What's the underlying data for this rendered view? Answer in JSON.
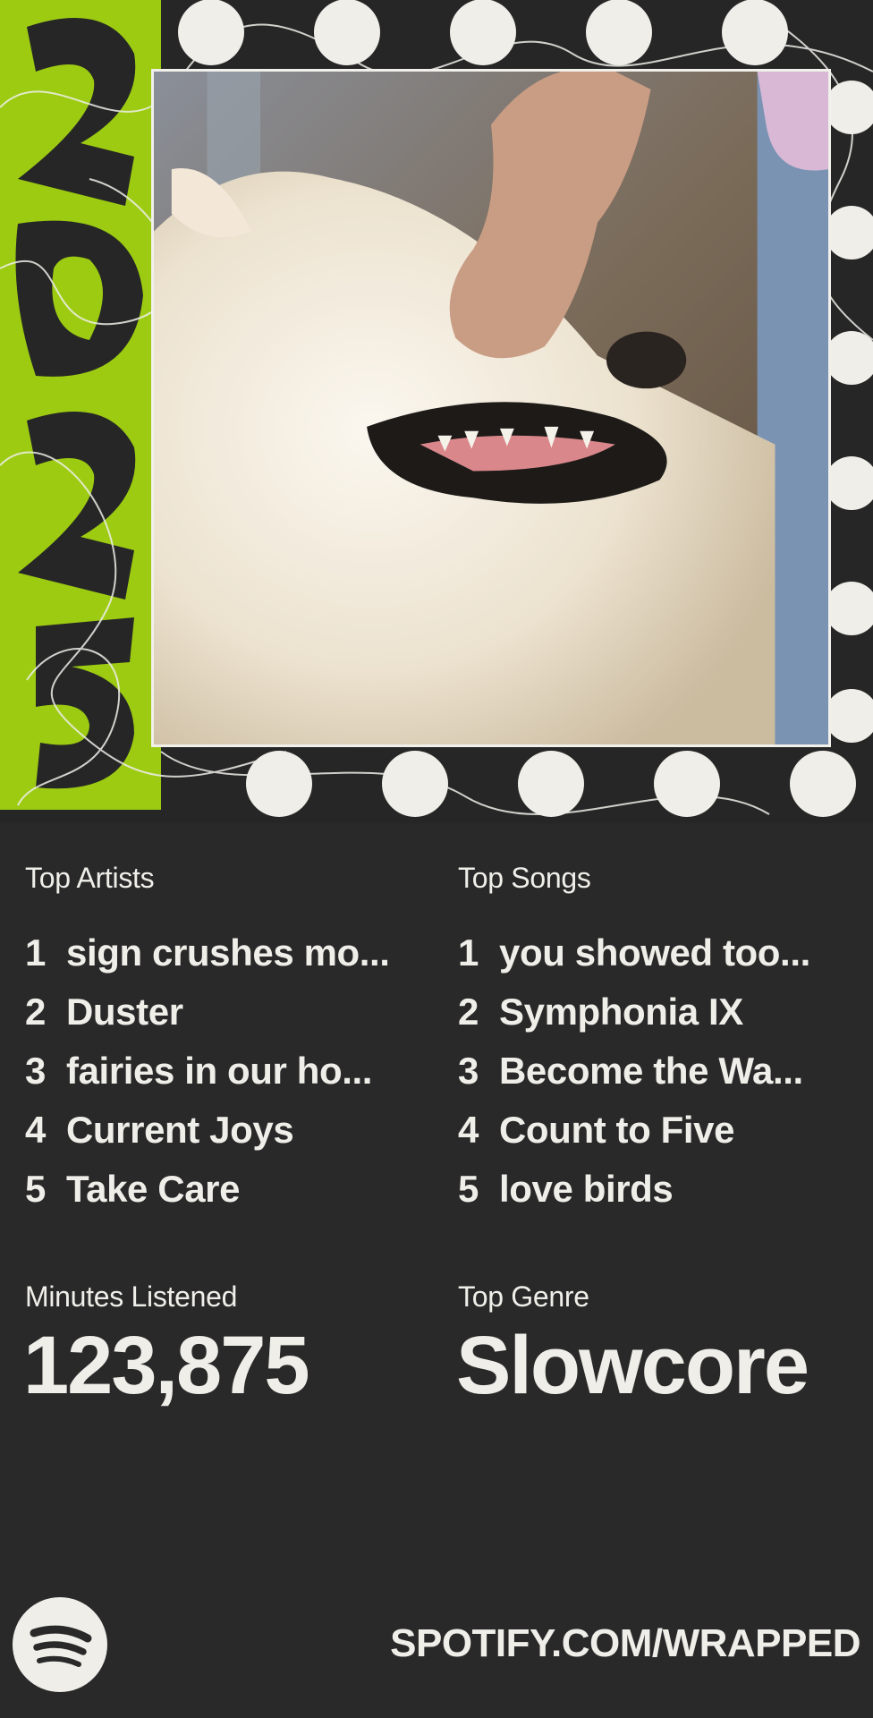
{
  "poster": {
    "year": "2025",
    "colors": {
      "background": "#292929",
      "accent": "#9ccb12",
      "text": "#efeee9"
    },
    "photo_icon": "dog-photo"
  },
  "top_artists": {
    "label": "Top Artists",
    "items": [
      {
        "rank": "1",
        "name": "sign crushes mo..."
      },
      {
        "rank": "2",
        "name": "Duster"
      },
      {
        "rank": "3",
        "name": "fairies in our ho..."
      },
      {
        "rank": "4",
        "name": "Current Joys"
      },
      {
        "rank": "5",
        "name": "Take Care"
      }
    ]
  },
  "top_songs": {
    "label": "Top Songs",
    "items": [
      {
        "rank": "1",
        "name": "you showed too..."
      },
      {
        "rank": "2",
        "name": "Symphonia IX"
      },
      {
        "rank": "3",
        "name": "Become the Wa..."
      },
      {
        "rank": "4",
        "name": "Count to Five"
      },
      {
        "rank": "5",
        "name": "love birds"
      }
    ]
  },
  "minutes": {
    "label": "Minutes Listened",
    "value": "123,875"
  },
  "genre": {
    "label": "Top Genre",
    "value": "Slowcore"
  },
  "footer": {
    "url": "SPOTIFY.COM/WRAPPED",
    "logo_icon": "spotify-logo-icon"
  }
}
